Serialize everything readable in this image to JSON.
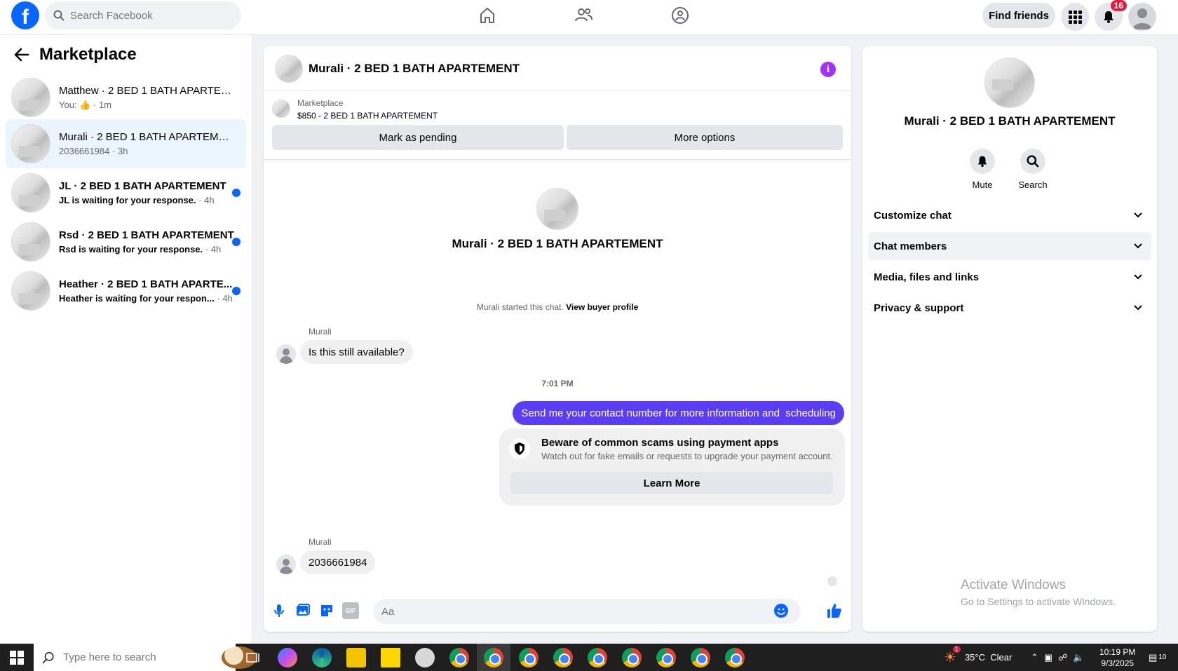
{
  "topbar": {
    "search_placeholder": "Search Facebook",
    "find_friends_label": "Find friends",
    "notification_count": "16",
    "logo_letter": "f"
  },
  "left": {
    "title": "Marketplace",
    "conversations": [
      {
        "name": "Matthew · 2 BED 1 BATH APARTEM...",
        "prefix": "You:",
        "time": "1m"
      },
      {
        "name": "Murali · 2 BED 1 BATH APARTEMENT",
        "sub": "2036661984",
        "time": "3h"
      },
      {
        "name": "JL · 2 BED 1 BATH APARTEMENT",
        "sub": "JL is waiting for your response.",
        "time": "4h"
      },
      {
        "name": "Rsd · 2 BED 1 BATH APARTEMENT",
        "sub": "Rsd is waiting for your response.",
        "time": "4h"
      },
      {
        "name": "Heather · 2 BED 1 BATH APARTE...",
        "sub": "Heather is waiting for your respon...",
        "time": "4h"
      }
    ]
  },
  "chat": {
    "title": "Murali · 2 BED 1 BATH APARTEMENT",
    "listing_label": "Marketplace",
    "listing_price": "$850 - 2 BED 1 BATH APARTEMENT",
    "mark_pending_label": "Mark as pending",
    "more_options_label": "More options",
    "center_name": "Murali · 2 BED 1 BATH APARTEMENT",
    "started_text": "Murali started this chat.",
    "view_profile_label": "View buyer profile",
    "messages": [
      {
        "sender": "Murali",
        "text": "Is this still available?"
      },
      {
        "time": "7:01 PM"
      },
      {
        "sender": "You",
        "text": "Send me your contact number for more information and  scheduling"
      },
      {
        "sender": "Murali",
        "text": "2036661984"
      }
    ],
    "scam_title": "Beware of common scams using payment apps",
    "scam_sub": "Watch out for fake emails or requests to upgrade your payment account.",
    "learn_more_label": "Learn More",
    "input_placeholder": "Aa",
    "gif_label": "GIF"
  },
  "right": {
    "name": "Murali · 2 BED 1 BATH APARTEMENT",
    "mute_label": "Mute",
    "search_label": "Search",
    "sections": [
      "Customize chat",
      "Chat members",
      "Media, files and links",
      "Privacy & support"
    ]
  },
  "watermark": {
    "line1": "Activate Windows",
    "line2": "Go to Settings to activate Windows."
  },
  "taskbar": {
    "search_placeholder": "Type here to search",
    "weather": "35°C  Clear",
    "weather_badge": "1",
    "time": "10:19 PM",
    "date": "9/3/2025",
    "notification_count": "10"
  },
  "colors": {
    "accent": "#0866ff",
    "outgoing_bubble": "#5b3df5",
    "info": "#a033ff"
  }
}
